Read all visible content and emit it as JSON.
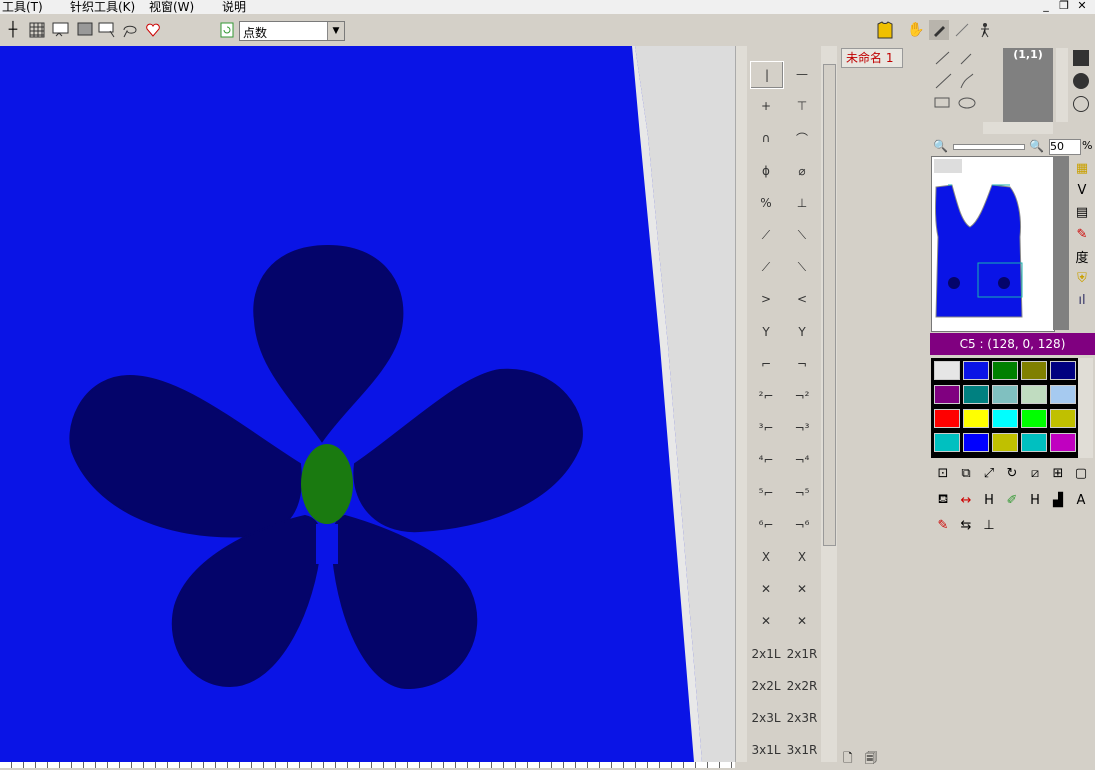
{
  "menu": [
    "工具(T)",
    "针织工具(K)",
    "视窗(W)",
    "说明"
  ],
  "window_buttons": [
    "minimize-icon",
    "restore-icon",
    "close-icon"
  ],
  "toolbar": {
    "icons": [
      "crosshair-icon",
      "grid-icon",
      "select-rect-icon",
      "fill-pattern-icon",
      "select-window-icon",
      "lasso-icon",
      "heart-icon"
    ],
    "refresh_icon": "refresh-icon",
    "combo_value": "点数",
    "right_icons": [
      "garment-icon",
      "hand-pan-icon",
      "brush-icon",
      "line-icon",
      "walker-icon"
    ]
  },
  "stitch_palette": {
    "rows": [
      [
        "|",
        "—"
      ],
      [
        "+",
        "⊤"
      ],
      [
        "∩",
        "⌒"
      ],
      [
        "ϕ",
        "⌀"
      ],
      [
        "%",
        "⊥"
      ],
      [
        "⟋",
        "⟍"
      ],
      [
        "⟋",
        "⟍"
      ],
      [
        ">",
        "<"
      ],
      [
        "Y",
        "Y"
      ],
      [
        "⌐",
        "¬"
      ],
      [
        "²⌐",
        "¬²"
      ],
      [
        "³⌐",
        "¬³"
      ],
      [
        "⁴⌐",
        "¬⁴"
      ],
      [
        "⁵⌐",
        "¬⁵"
      ],
      [
        "⁶⌐",
        "¬⁶"
      ],
      [
        "X",
        "X"
      ],
      [
        "✕",
        "✕"
      ],
      [
        "✕",
        "✕"
      ],
      [
        "2x1L",
        "2x1R"
      ],
      [
        "2x2L",
        "2x2R"
      ],
      [
        "2x3L",
        "2x3R"
      ],
      [
        "3x1L",
        "3x1R"
      ]
    ]
  },
  "document_tab": "未命名 1",
  "small_preview_coords": "(1,1)",
  "zoom_value": "50",
  "zoom_unit": "%",
  "current_color_label": "C5 : (128, 0, 128)",
  "palette_colors": [
    [
      "#e6e6e6",
      "#0a14e6",
      "#008000",
      "#808000",
      "#000080"
    ],
    [
      "#800080",
      "#008080",
      "#80c0c0",
      "#c0dcc0",
      "#a6caf0"
    ],
    [
      "#ff0000",
      "#ffff00",
      "#00ffff",
      "#00ff00",
      "#c0c000"
    ],
    [
      "#00c0c0",
      "#0000ff",
      "#c0c000",
      "#00c0c0",
      "#c000c0"
    ]
  ],
  "side_tool_icons": [
    "layer-grid-icon",
    "v-neck-icon",
    "table-icon",
    "pen-icon",
    "degree-icon",
    "shield-icon",
    "bars-icon"
  ],
  "side_tool_label_degree": "度",
  "bottom_tools": [
    "fill-bucket-icon",
    "arrows-icon",
    "h-bracket-icon",
    "brush-tool-icon",
    "h-bracket-alt-icon",
    "stats-icon",
    "letter-a-icon",
    "pen-red-icon",
    "swap-icon",
    "layout-icon"
  ],
  "colors": {
    "canvas_blue": "#0a14e6",
    "petal_navy": "#04046a",
    "center_green": "#1a7a10",
    "margin_gray": "#dcdcdc"
  }
}
